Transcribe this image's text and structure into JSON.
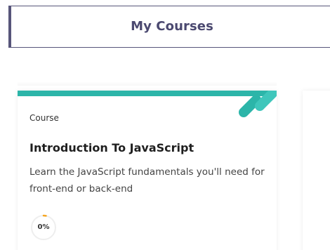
{
  "header": {
    "title": "My Courses"
  },
  "course_card": {
    "type_label": "Course",
    "title": "Introduction To JavaScript",
    "description": "Learn the JavaScript fundamentals you'll need for front-end or back-end",
    "progress_text": "0%",
    "progress_value": 0
  },
  "colors": {
    "header_border": "#57557a",
    "title_text": "#4b4970",
    "accent_teal": "#2cb5a9",
    "progress_orange": "#f5a623"
  },
  "icons": {
    "card_decoration": "teal-diagonal-bars-icon"
  }
}
